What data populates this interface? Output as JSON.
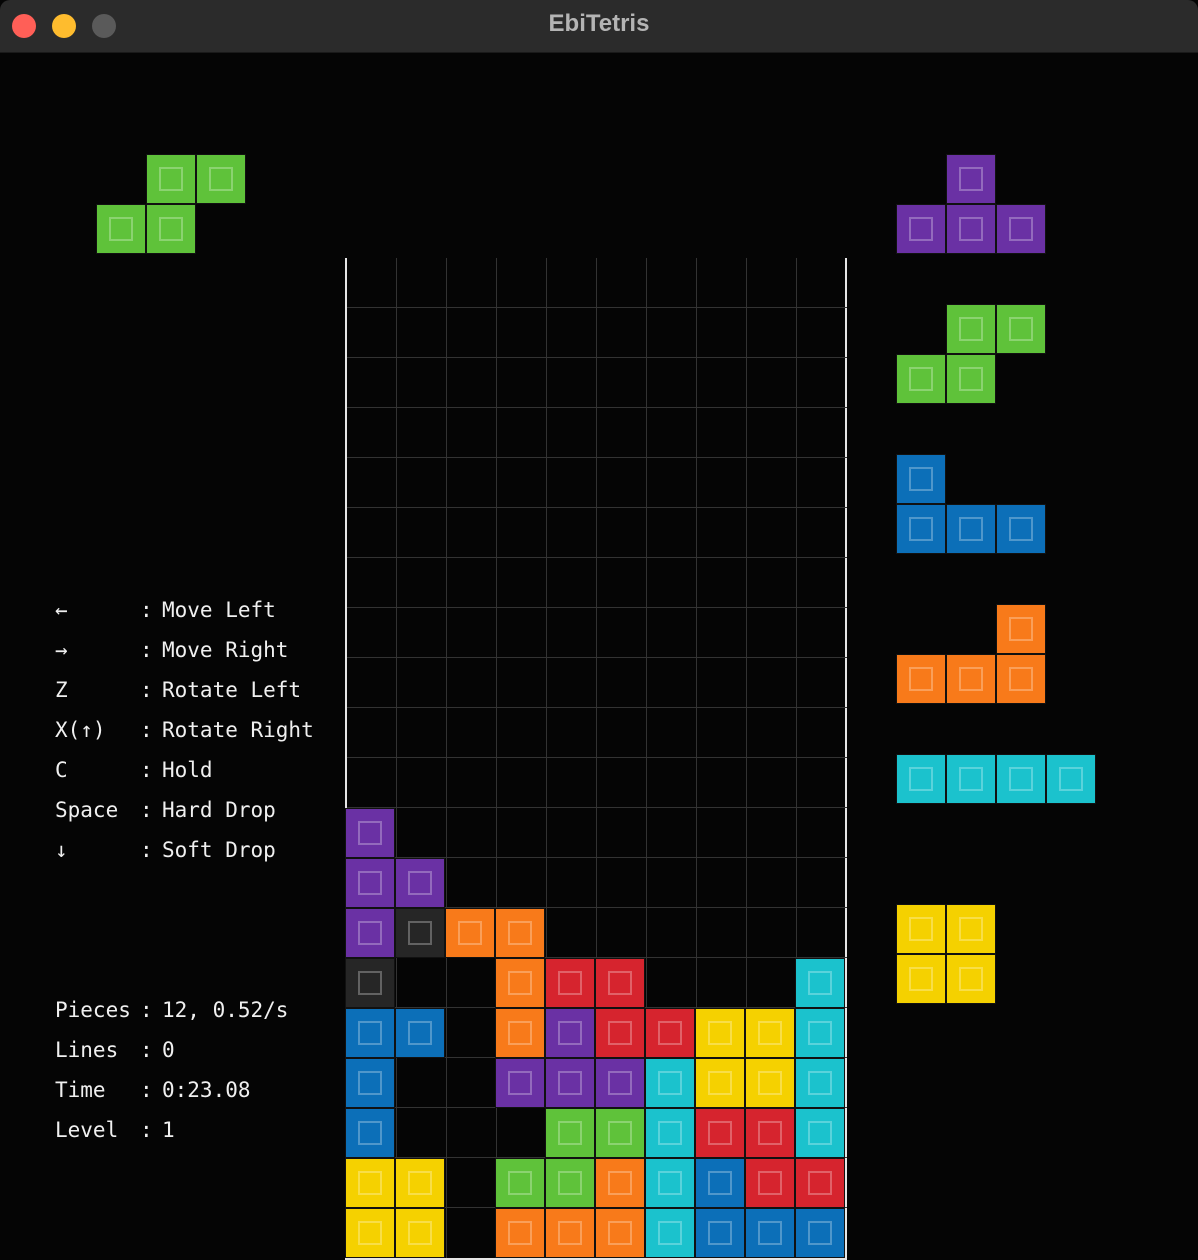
{
  "window": {
    "title": "EbiTetris"
  },
  "colors": {
    "T": "#6a31a4",
    "S": "#5fc23a",
    "J": "#0c6fb8",
    "L": "#f87a1a",
    "I": "#1bc2cd",
    "O": "#f5d100",
    "Z": "#d6242e",
    "X": "#262626"
  },
  "hold": {
    "piece": "S"
  },
  "next": [
    "T",
    "S",
    "J",
    "L",
    "I",
    "O"
  ],
  "board": {
    "rows": [
      "..........",
      "..........",
      "..........",
      "..........",
      "..........",
      "..........",
      "..........",
      "..........",
      "..........",
      "..........",
      "..........",
      "T.........",
      "TT........",
      "TXLL......",
      "X..LZZ...I",
      "JJ.LTZZOOI",
      "J..TTTIOOI",
      "J...SSIZZI",
      "OO.SSLIJZZ",
      "OO.LLLIJJJ"
    ]
  },
  "controls": [
    {
      "key": "←",
      "sep": ":",
      "action": "Move Left"
    },
    {
      "key": "→",
      "sep": ":",
      "action": "Move Right"
    },
    {
      "key": "Z",
      "sep": ":",
      "action": "Rotate Left"
    },
    {
      "key": "X(↑)",
      "sep": ":",
      "action": "Rotate Right"
    },
    {
      "key": "C",
      "sep": ":",
      "action": "Hold"
    },
    {
      "key": "Space",
      "sep": ":",
      "action": "Hard Drop"
    },
    {
      "key": "↓",
      "sep": ":",
      "action": "Soft Drop"
    }
  ],
  "stats": [
    {
      "label": "Pieces",
      "sep": ":",
      "value": "12, 0.52/s"
    },
    {
      "label": "Lines",
      "sep": ":",
      "value": "0"
    },
    {
      "label": "Time",
      "sep": ":",
      "value": "0:23.08"
    },
    {
      "label": "Level",
      "sep": ":",
      "value": "1"
    }
  ]
}
